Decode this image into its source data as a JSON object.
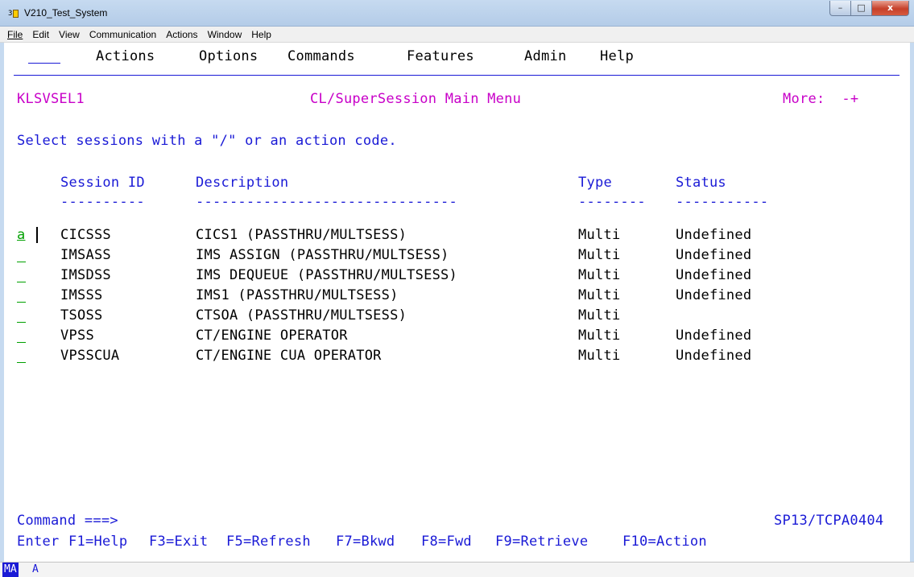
{
  "window": {
    "title": "V210_Test_System",
    "icon": "terminal-app-icon",
    "controls": {
      "minimize": "–",
      "maximize": "□",
      "close": "x"
    }
  },
  "window_menu": [
    "File",
    "Edit",
    "View",
    "Communication",
    "Actions",
    "Window",
    "Help"
  ],
  "action_bar": [
    "Actions",
    "Options",
    "Commands",
    "Features",
    "Admin",
    "Help"
  ],
  "panel": {
    "id": "KLSVSEL1",
    "title": "CL/SuperSession Main Menu",
    "more": "More:  -+",
    "instruction": "Select sessions with a \"/\" or an action code."
  },
  "table": {
    "columns": [
      "Session ID",
      "Description",
      "Type",
      "Status"
    ],
    "dashes": [
      "----------",
      "-------------------------------",
      "--------",
      "-----------"
    ],
    "rows": [
      {
        "sel": "a",
        "id": "CICSSS",
        "desc": "CICS1 (PASSTHRU/MULTSESS)",
        "type": "Multi",
        "status": "Undefined"
      },
      {
        "sel": "",
        "id": "IMSASS",
        "desc": "IMS ASSIGN (PASSTHRU/MULTSESS)",
        "type": "Multi",
        "status": "Undefined"
      },
      {
        "sel": "",
        "id": "IMSDSS",
        "desc": "IMS DEQUEUE (PASSTHRU/MULTSESS)",
        "type": "Multi",
        "status": "Undefined"
      },
      {
        "sel": "",
        "id": "IMSSS",
        "desc": "IMS1 (PASSTHRU/MULTSESS)",
        "type": "Multi",
        "status": "Undefined"
      },
      {
        "sel": "",
        "id": "TSOSS",
        "desc": "CTSOA (PASSTHRU/MULTSESS)",
        "type": "Multi",
        "status": ""
      },
      {
        "sel": "",
        "id": "VPSS",
        "desc": "CT/ENGINE OPERATOR",
        "type": "Multi",
        "status": "Undefined"
      },
      {
        "sel": "",
        "id": "VPSSCUA",
        "desc": "CT/ENGINE CUA OPERATOR",
        "type": "Multi",
        "status": "Undefined"
      }
    ]
  },
  "command": {
    "prompt": "Command ===>",
    "system_id": "SP13/TCPA0404",
    "value": ""
  },
  "function_keys": [
    "Enter",
    "F1=Help",
    "F3=Exit",
    "F5=Refresh",
    "F7=Bkwd",
    "F8=Fwd",
    "F9=Retrieve",
    "F10=Action"
  ],
  "oia": {
    "mode": "MA",
    "indicator": "A"
  },
  "colors": {
    "field": "#1a1ad6",
    "text": "#000000",
    "highlight": "#c800c8",
    "selected": "#00a000"
  }
}
